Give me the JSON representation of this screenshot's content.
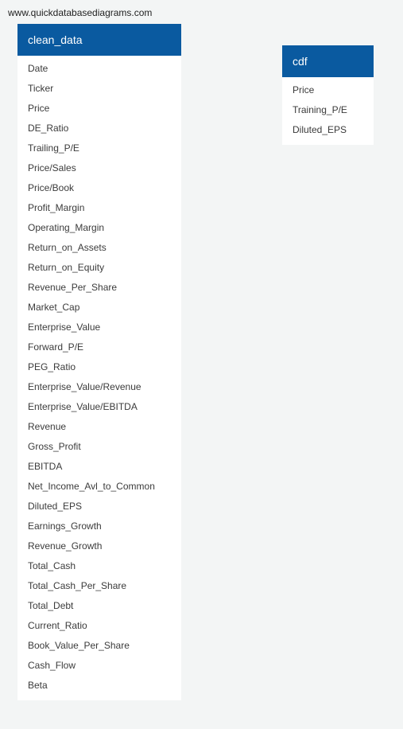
{
  "watermark": "www.quickdatabasediagrams.com",
  "tables": [
    {
      "name": "clean_data",
      "fields": [
        "Date",
        "Ticker",
        "Price",
        "DE_Ratio",
        "Trailing_P/E",
        "Price/Sales",
        "Price/Book",
        "Profit_Margin",
        "Operating_Margin",
        "Return_on_Assets",
        "Return_on_Equity",
        "Revenue_Per_Share",
        "Market_Cap",
        "Enterprise_Value",
        "Forward_P/E",
        "PEG_Ratio",
        "Enterprise_Value/Revenue",
        "Enterprise_Value/EBITDA",
        "Revenue",
        "Gross_Profit",
        "EBITDA",
        "Net_Income_Avl_to_Common",
        "Diluted_EPS",
        "Earnings_Growth",
        "Revenue_Growth",
        "Total_Cash",
        "Total_Cash_Per_Share",
        "Total_Debt",
        "Current_Ratio",
        "Book_Value_Per_Share",
        "Cash_Flow",
        "Beta"
      ]
    },
    {
      "name": "cdf",
      "fields": [
        "Price",
        "Training_P/E",
        "Diluted_EPS"
      ]
    }
  ],
  "colors": {
    "header_bg": "#0a5aa0",
    "header_text": "#ffffff",
    "canvas_bg": "#f3f5f5",
    "table_bg": "#ffffff",
    "field_text": "#3b3b3b"
  }
}
